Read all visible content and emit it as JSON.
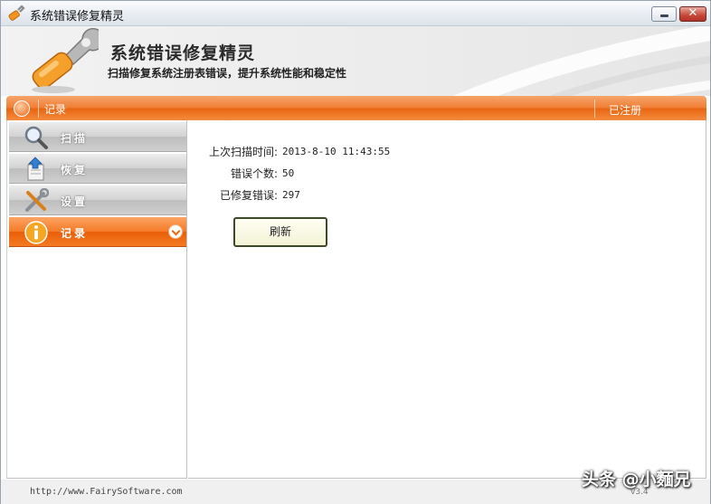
{
  "window": {
    "title": "系统错误修复精灵"
  },
  "banner": {
    "app_name": "系统错误修复精灵",
    "description": "扫描修复系统注册表错误，提升系统性能和稳定性"
  },
  "navbar": {
    "breadcrumb": "记录",
    "status": "已注册"
  },
  "sidebar": {
    "items": [
      {
        "label": "扫描",
        "icon": "magnifier-icon",
        "active": false
      },
      {
        "label": "恢复",
        "icon": "restore-icon",
        "active": false
      },
      {
        "label": "设置",
        "icon": "tools-icon",
        "active": false
      },
      {
        "label": "记录",
        "icon": "info-icon",
        "active": true
      }
    ]
  },
  "record": {
    "last_scan_label": "上次扫描时间:",
    "last_scan_value": "2013-8-10 11:43:55",
    "errors_label": "错误个数:",
    "errors_value": "50",
    "fixed_label": "已修复错误:",
    "fixed_value": "297",
    "refresh_label": "刷新"
  },
  "footer": {
    "url": "http://www.FairySoftware.com",
    "version": "v3.4"
  },
  "watermark": "头条 @小麵兄",
  "colors": {
    "accent": "#f07d33",
    "accent_dark": "#e8640f",
    "sidebar_gray": "#c8c8c8"
  }
}
